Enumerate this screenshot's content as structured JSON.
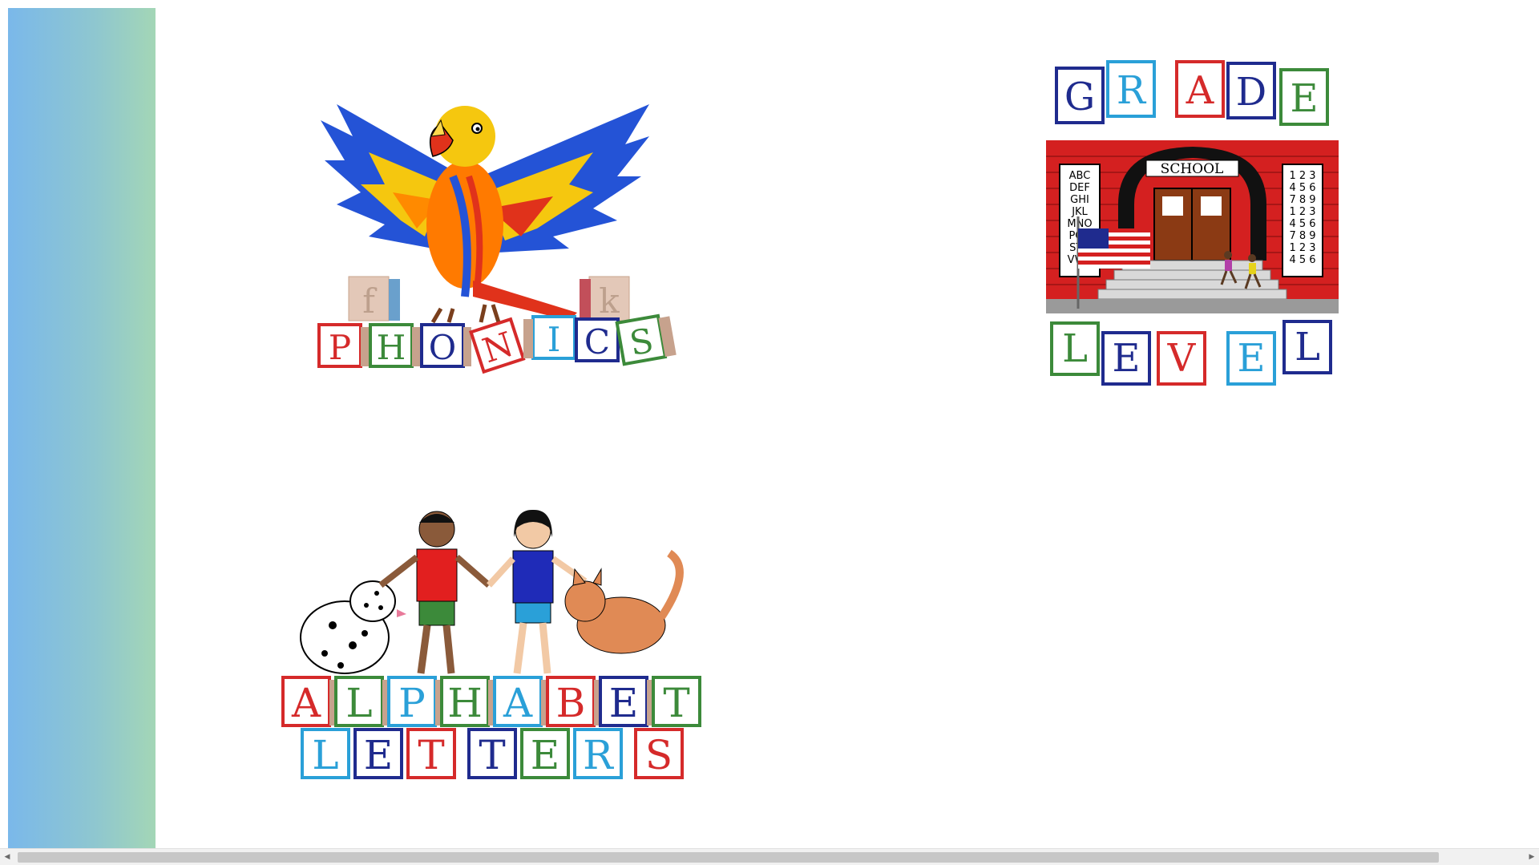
{
  "sidebar": {
    "gradient_colors": [
      "#7ab8ea",
      "#a3d6b6"
    ]
  },
  "tiles": {
    "phonics": {
      "word": "PHONICS",
      "small_blocks": [
        "f",
        "k"
      ]
    },
    "grade_level": {
      "top_word": "GRADE",
      "bottom_word": "LEVEL",
      "building_sign": "SCHOOL",
      "left_chart": [
        "ABC",
        "DEF",
        "GHI",
        "JKL",
        "MNO",
        "PQR",
        "STU",
        "VWX"
      ],
      "right_chart": [
        "1 2 3",
        "4 5 6",
        "7 8 9",
        "1 2 3",
        "4 5 6",
        "7 8 9",
        "1 2 3",
        "4 5 6"
      ]
    },
    "alphabet_letters": {
      "top_word": "ALPHABET",
      "bottom_word": "LETTERS"
    }
  },
  "scrollbar": {
    "left_arrow": "◀",
    "right_arrow": "▶"
  }
}
